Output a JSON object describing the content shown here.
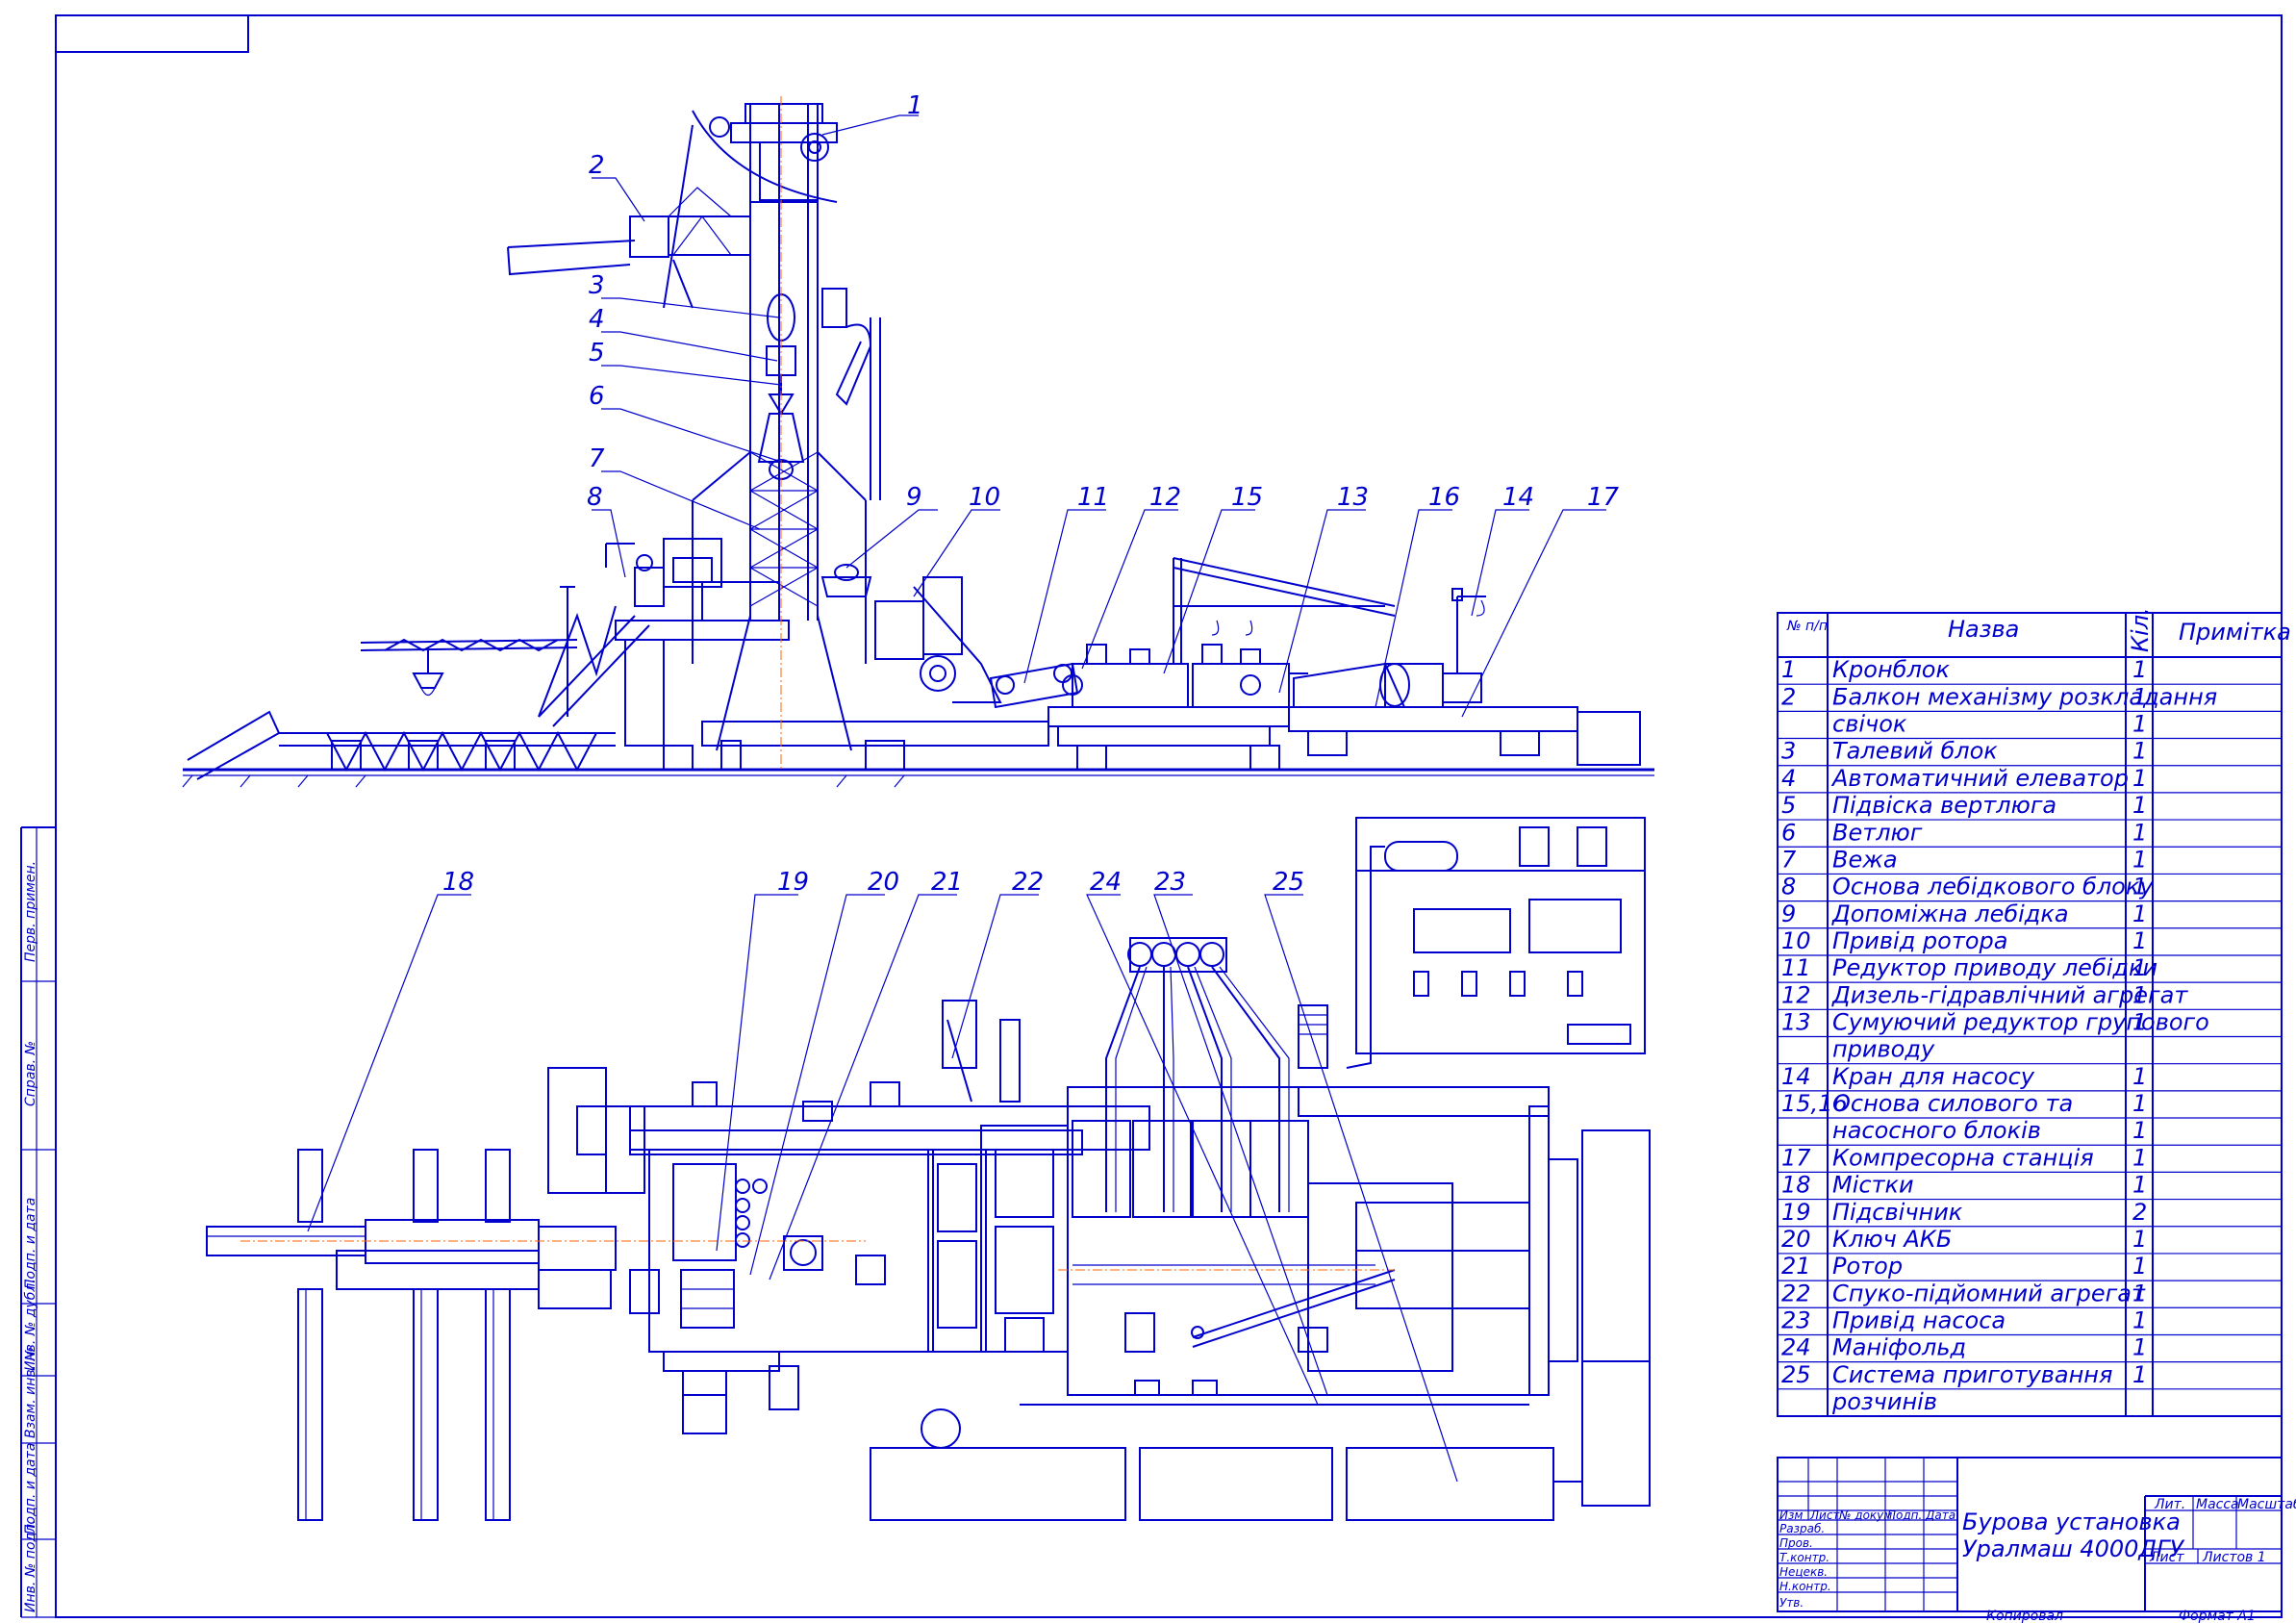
{
  "callouts": [
    "1",
    "2",
    "3",
    "4",
    "5",
    "6",
    "7",
    "8",
    "9",
    "10",
    "11",
    "12",
    "15",
    "13",
    "16",
    "14",
    "17",
    "18",
    "19",
    "20",
    "21",
    "22",
    "24",
    "23",
    "25"
  ],
  "spec_table": {
    "headers": {
      "number": "№ п/п",
      "name": "Назва",
      "qty": "Кіл.",
      "note": "Примітка"
    },
    "rows": [
      {
        "n": "1",
        "name": "Кронблок",
        "qty": "1"
      },
      {
        "n": "2",
        "name": "Балкон механізму розкладання",
        "qty": "1"
      },
      {
        "n": "",
        "name": "свічок",
        "qty": "1"
      },
      {
        "n": "3",
        "name": "Талевий блок",
        "qty": "1"
      },
      {
        "n": "4",
        "name": "Автоматичний елеватор",
        "qty": "1"
      },
      {
        "n": "5",
        "name": "Підвіска вертлюга",
        "qty": "1"
      },
      {
        "n": "6",
        "name": "Ветлюг",
        "qty": "1"
      },
      {
        "n": "7",
        "name": "Вежа",
        "qty": "1"
      },
      {
        "n": "8",
        "name": "Основа лебідкового блоку",
        "qty": "1"
      },
      {
        "n": "9",
        "name": "Допоміжна лебідка",
        "qty": "1"
      },
      {
        "n": "10",
        "name": "Привід ротора",
        "qty": "1"
      },
      {
        "n": "11",
        "name": "Редуктор приводу лебідки",
        "qty": "1"
      },
      {
        "n": "12",
        "name": "Дизель-гідравлічний агрегат",
        "qty": "1"
      },
      {
        "n": "13",
        "name": "Сумуючий редуктор групового",
        "qty": "1"
      },
      {
        "n": "",
        "name": "приводу",
        "qty": ""
      },
      {
        "n": "14",
        "name": "Кран для насосу",
        "qty": "1"
      },
      {
        "n": "15,16",
        "name": "Основа силового та",
        "qty": "1"
      },
      {
        "n": "",
        "name": "насосного блоків",
        "qty": "1"
      },
      {
        "n": "17",
        "name": "Компресорна станція",
        "qty": "1"
      },
      {
        "n": "18",
        "name": "Містки",
        "qty": "1"
      },
      {
        "n": "19",
        "name": "Підсвічник",
        "qty": "2"
      },
      {
        "n": "20",
        "name": "Ключ АКБ",
        "qty": "1"
      },
      {
        "n": "21",
        "name": "Ротор",
        "qty": "1"
      },
      {
        "n": "22",
        "name": "Спуко-підйомний агрегат",
        "qty": "1"
      },
      {
        "n": "23",
        "name": "Привід насоса",
        "qty": "1"
      },
      {
        "n": "24",
        "name": "Маніфольд",
        "qty": "1"
      },
      {
        "n": "25",
        "name": "Система приготування",
        "qty": "1"
      },
      {
        "n": "",
        "name": "розчинів",
        "qty": ""
      }
    ]
  },
  "title_block": {
    "title_line1": "Бурова установка",
    "title_line2": "Уралмаш 4000ДГУ",
    "col_headers": [
      "Изм",
      "Лист",
      "№ докум.",
      "Подп.",
      "Дата"
    ],
    "roles": [
      "Разраб.",
      "Пров.",
      "Т.контр.",
      "Нецекв.",
      "Н.контр.",
      "Утв."
    ],
    "lit": "Лит.",
    "mass": "Масса",
    "scale": "Масштаб",
    "sheet": "Лист",
    "sheets": "Листов 1",
    "copied": "Копировал",
    "format": "Формат А1"
  },
  "side_stamp": [
    "Перв. примен.",
    "Справ. №",
    "Подп. и дата",
    "Инв. № дубл.",
    "Взам. инв. №",
    "Подп. и дата",
    "Инв. № подл."
  ]
}
